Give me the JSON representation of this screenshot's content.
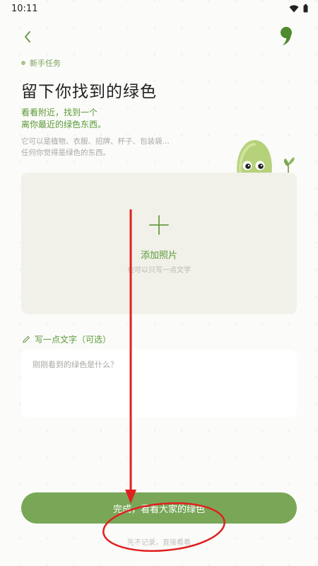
{
  "status_bar": {
    "time": "10:11"
  },
  "header": {
    "back_icon": "chevron-left-icon",
    "brand_icon": "comma-logo-icon"
  },
  "task_tag": "新手任务",
  "title": "留下你找到的绿色",
  "subtitle_green": [
    "看看附近，找到一个",
    "离你最近的绿色东西。"
  ],
  "subtitle_gray": [
    "它可以是植物、衣服、招牌、杯子、包装袋…",
    "任何你觉得是绿色的东西。"
  ],
  "upload": {
    "label": "添加照片",
    "hint": "也可以只写一点文字"
  },
  "note": {
    "label": "写一点文字（可选）",
    "placeholder": "刚刚看到的绿色是什么？"
  },
  "actions": {
    "done": "完成，看看大家的绿色",
    "skip": "先不记录，直接看看"
  },
  "colors": {
    "accent": "#79a757",
    "annotation": "#e02020"
  }
}
